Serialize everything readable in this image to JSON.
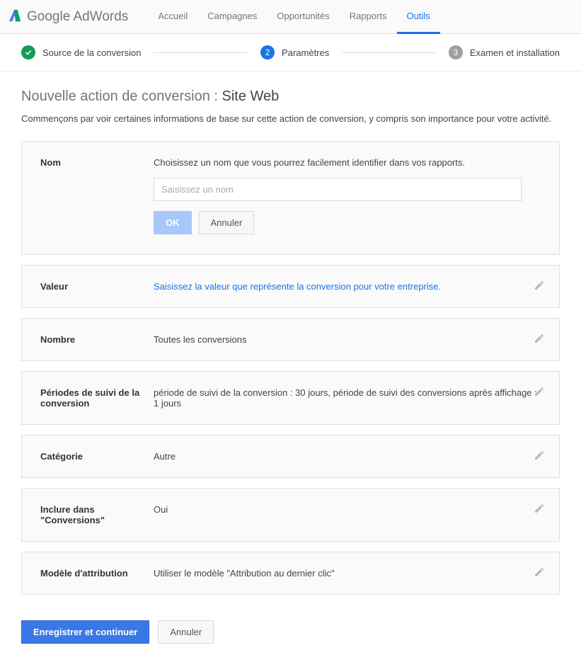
{
  "header": {
    "brand_prefix": "Google",
    "brand_suffix": " AdWords",
    "nav": {
      "accueil": "Accueil",
      "campagnes": "Campagnes",
      "opportunites": "Opportunités",
      "rapports": "Rapports",
      "outils": "Outils"
    }
  },
  "stepper": {
    "step1": "Source de la conversion",
    "step2_num": "2",
    "step2": "Paramètres",
    "step3_num": "3",
    "step3": "Examen et installation"
  },
  "page": {
    "title_prefix": "Nouvelle action de conversion : ",
    "title_main": "Site Web",
    "description": "Commençons par voir certaines informations de base sur cette action de conversion, y compris son importance pour votre activité."
  },
  "fields": {
    "nom": {
      "label": "Nom",
      "help": "Choisissez un nom que vous pourrez facilement identifier dans vos rapports.",
      "placeholder": "Saisissez un nom",
      "ok": "OK",
      "cancel": "Annuler"
    },
    "valeur": {
      "label": "Valeur",
      "value": "Saisissez la valeur que représente la conversion pour votre entreprise."
    },
    "nombre": {
      "label": "Nombre",
      "value": "Toutes les conversions"
    },
    "periodes": {
      "label": "Périodes de suivi de la conversion",
      "value": "période de suivi de la conversion : 30 jours, période de suivi des conversions après affichage : 1 jours"
    },
    "categorie": {
      "label": "Catégorie",
      "value": "Autre"
    },
    "inclure": {
      "label": "Inclure dans \"Conversions\"",
      "value": "Oui"
    },
    "modele": {
      "label": "Modèle d'attribution",
      "value": "Utiliser le modèle \"Attribution au dernier clic\""
    }
  },
  "footer": {
    "save": "Enregistrer et continuer",
    "cancel": "Annuler"
  }
}
